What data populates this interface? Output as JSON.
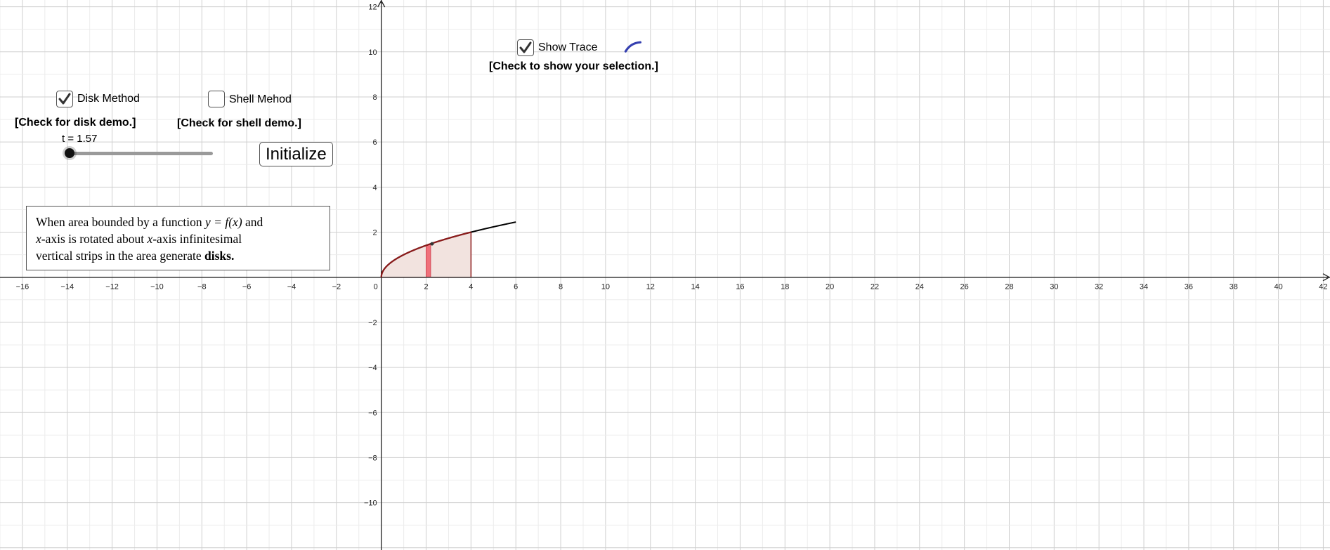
{
  "graph": {
    "x_ticks": [
      -16,
      -14,
      -12,
      -10,
      -8,
      -6,
      -4,
      -2,
      0,
      2,
      4,
      6,
      8,
      10,
      12,
      14,
      16,
      18,
      20,
      22,
      24,
      26,
      28,
      30,
      32,
      34,
      36,
      38,
      40,
      42
    ],
    "y_ticks": [
      -10,
      -8,
      -6,
      -4,
      -2,
      2,
      4,
      6,
      8,
      10,
      12
    ],
    "colors": {
      "curve": "#000000",
      "region_border": "#8b1a1a",
      "region_fill": "#f2e3df",
      "strip": "#f0707a",
      "trace": "#3540b0",
      "grid": "#c8c8c8"
    }
  },
  "chart_data": {
    "type": "line",
    "xlim": [
      -17,
      42.3
    ],
    "ylim": [
      -12.1,
      12.3
    ],
    "grid": true,
    "curve": {
      "expression": "y = f(x)",
      "x_range": [
        0,
        6
      ],
      "samples": [
        [
          0,
          0
        ],
        [
          0.5,
          0.71
        ],
        [
          1,
          1
        ],
        [
          2,
          1.41
        ],
        [
          3,
          1.73
        ],
        [
          4,
          2
        ],
        [
          5,
          2.24
        ],
        [
          6,
          2.45
        ]
      ]
    },
    "shaded_region": {
      "x_range": [
        0,
        4
      ]
    },
    "strip": {
      "x_range": [
        2,
        2.2
      ]
    },
    "trace_point": {
      "x": 11.3,
      "y": 10.3
    }
  },
  "controls": {
    "disk": {
      "label": "Disk Method",
      "caption": "[Check for disk demo.]",
      "checked": true
    },
    "shell": {
      "label": "Shell Mehod",
      "caption": "[Check for shell demo.]",
      "checked": false
    },
    "trace": {
      "label": "Show Trace",
      "caption": "[Check to show your selection.]",
      "checked": true
    },
    "slider": {
      "label": "t = 1.57",
      "value": 1.57,
      "fraction": 0
    },
    "initialize_label": "Initialize"
  },
  "textbox": {
    "line1_a": "When area bounded by a function ",
    "line1_math": "y = f(x)",
    "line1_b": " and",
    "line2_math1": "x",
    "line2_a": "-axis is rotated about ",
    "line2_math2": "x",
    "line2_b": "-axis infinitesimal",
    "line3_a": "vertical strips in the area generate ",
    "line3_bold": "disks."
  }
}
